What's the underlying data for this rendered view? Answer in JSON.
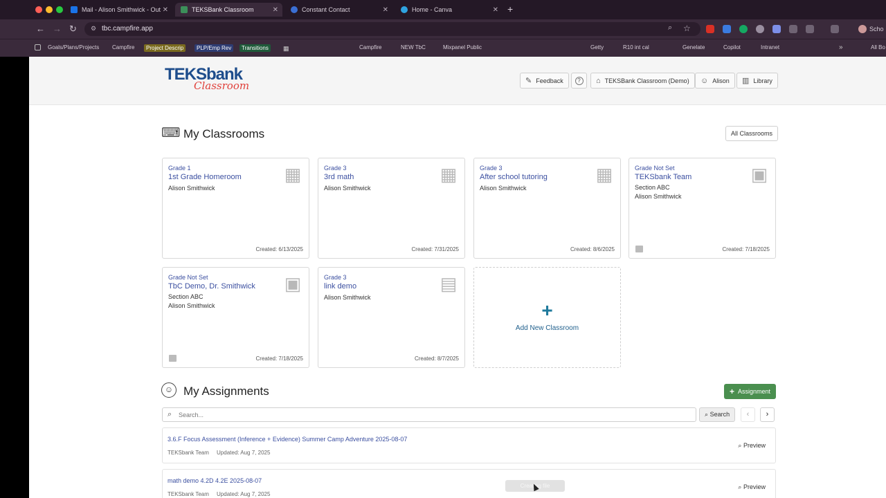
{
  "browser": {
    "tabs": [
      {
        "label": "Mail - Alison Smithwick - Out",
        "fav_color": "#1a73e8"
      },
      {
        "label": "TEKSBank Classroom",
        "fav_color": "#3c8f5a"
      },
      {
        "label": "Constant Contact",
        "fav_color": "#3b6fd4"
      },
      {
        "label": "Home - Canva",
        "fav_color": "#2fa3e0"
      }
    ],
    "new_tab": "+",
    "url": "tbc.campfire.app",
    "profile_label": "Scho",
    "bookmarks": [
      "Goals/Plans/Projects",
      "Campfire",
      "Project Descrip",
      "PLP/Emp Rev",
      "Transitions",
      "Campfire",
      "NEW TbC",
      "Mixpanel Public",
      "Getty",
      "R10 int cal",
      "Genelate",
      "Copilot",
      "Intranet",
      "All Bo"
    ]
  },
  "header": {
    "logo_main": "TEKSbank",
    "logo_sub": "Classroom",
    "buttons": {
      "feedback": "Feedback",
      "help": "?",
      "org": "TEKSBank Classroom (Demo)",
      "user": "Alison",
      "library": "Library"
    }
  },
  "classrooms": {
    "title": "My Classrooms",
    "all_button": "All Classrooms",
    "cards": [
      {
        "grade": "Grade 1",
        "name": "1st Grade Homeroom",
        "lines": [
          "Alison Smithwick"
        ],
        "created": "Created: 6/13/2025"
      },
      {
        "grade": "Grade 3",
        "name": "3rd math",
        "lines": [
          "Alison Smithwick"
        ],
        "created": "Created: 7/31/2025"
      },
      {
        "grade": "Grade 3",
        "name": "After school tutoring",
        "lines": [
          "Alison Smithwick"
        ],
        "created": "Created: 8/6/2025"
      },
      {
        "grade": "Grade Not Set",
        "name": "TEKSbank Team",
        "lines": [
          "Section ABC",
          "Alison Smithwick"
        ],
        "created": "Created: 7/18/2025"
      },
      {
        "grade": "Grade Not Set",
        "name": "TbC Demo, Dr. Smithwick",
        "lines": [
          "Section ABC",
          "Alison Smithwick"
        ],
        "created": "Created: 7/18/2025"
      },
      {
        "grade": "Grade 3",
        "name": "link demo",
        "lines": [
          "Alison Smithwick"
        ],
        "created": "Created: 8/7/2025"
      }
    ],
    "add_label": "Add New Classroom"
  },
  "assignments": {
    "title": "My Assignments",
    "add_button": "Assignment",
    "search_placeholder": "Search...",
    "search_button": "Search",
    "prev": "‹",
    "next": "›",
    "rows": [
      {
        "title": "3.6.F Focus Assessment (Inference + Evidence) Summer Camp Adventure 2025-08-07",
        "team": "TEKSbank Team",
        "updated": "Updated: Aug 7, 2025",
        "preview": "Preview"
      },
      {
        "title": "math demo 4.2D 4.2E 2025-08-07",
        "team": "TEKSbank Team",
        "updated": "Updated: Aug 7, 2025",
        "preview": "Preview"
      }
    ]
  },
  "toast": "Creating file"
}
